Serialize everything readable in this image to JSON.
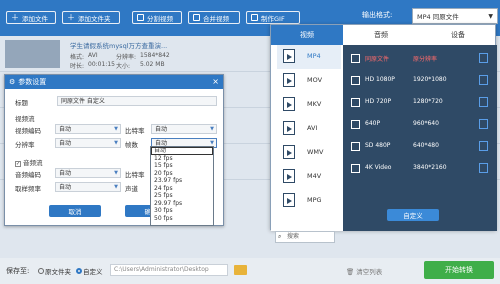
{
  "toolbar": {
    "add_file": "添加文件",
    "add_folder": "添加文件夹",
    "split_video": "分割视频",
    "merge_video": "合并视频",
    "make_gif": "制作GIF",
    "output_format_label": "输出格式:",
    "output_format_value": "MP4  同原文件"
  },
  "files": [
    {
      "name": "学生请假系统mysql万方查重演...",
      "format_label": "格式:",
      "format_value": "AVI",
      "res_label": "分辨率:",
      "res_value": "1584*842",
      "dur_label": "时长:",
      "dur_value": "00:01:15",
      "size_label": "大小:",
      "size_value": "5.02 MB"
    }
  ],
  "dialog": {
    "title": "参数设置",
    "close": "×",
    "title_label": "标题",
    "title_value": "同原文件 自定义",
    "video_section": "视频流",
    "video_codec_label": "视频编码",
    "video_codec_value": "自动",
    "bitrate_label": "比特率",
    "bitrate_value": "自动",
    "resolution_label": "分辨率",
    "resolution_value": "自动",
    "framerate_label": "帧数",
    "framerate_value": "自动",
    "audio_section": "音频流",
    "audio_codec_label": "音频编码",
    "audio_codec_value": "自动",
    "audio_bitrate_label": "比特率",
    "sample_label": "取样频率",
    "sample_value": "自动",
    "channel_label": "声道",
    "cancel": "取消",
    "confirm": "确认"
  },
  "fps_options": [
    "自动",
    "12 fps",
    "15 fps",
    "20 fps",
    "23.97 fps",
    "24 fps",
    "25 fps",
    "29.97 fps",
    "30 fps",
    "50 fps"
  ],
  "format_panel": {
    "tabs": [
      "视频",
      "音频",
      "设备"
    ],
    "formats": [
      "MP4",
      "MOV",
      "MKV",
      "AVI",
      "WMV",
      "M4V",
      "MPG"
    ],
    "presets": [
      {
        "name": "同原文件",
        "value": "原分辨率"
      },
      {
        "name": "HD 1080P",
        "value": "1920*1080"
      },
      {
        "name": "HD 720P",
        "value": "1280*720"
      },
      {
        "name": "640P",
        "value": "960*640"
      },
      {
        "name": "SD 480P",
        "value": "640*480"
      },
      {
        "name": "4K Video",
        "value": "3840*2160"
      }
    ],
    "search_placeholder": "搜索",
    "custom_button": "自定义"
  },
  "bottom": {
    "save_to_label": "保存至:",
    "original_folder": "原文件夹",
    "custom_option": "自定义",
    "path": "C:\\Users\\Administrator\\Desktop",
    "clear_list": "清空列表",
    "start_convert": "开始转换"
  },
  "colors": {
    "brand_blue": "#2f78c4",
    "panel_dark": "#2f4a66",
    "start_green": "#3fae49"
  }
}
